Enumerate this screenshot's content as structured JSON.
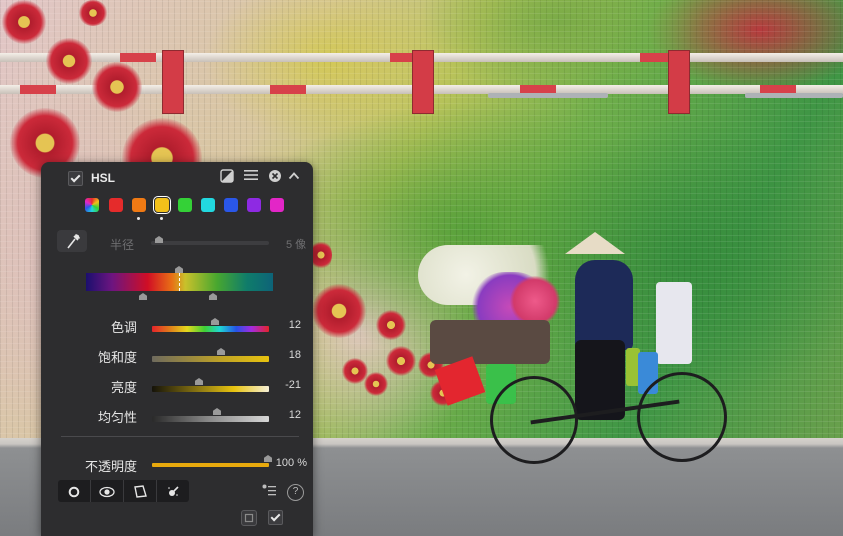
{
  "panel": {
    "title": "HSL",
    "colors": {
      "all": "multicolor",
      "red": "#e52b2b",
      "orange": "#f07a14",
      "yellow": "#f2c01a",
      "green": "#34d137",
      "aqua": "#22d8df",
      "blue": "#2a57e8",
      "purple": "#8e2ae3",
      "magenta": "#e326c7"
    },
    "selected_color": "yellow",
    "radius": {
      "label": "半径",
      "value": "5 像"
    },
    "sliders": [
      {
        "label": "色调",
        "value": "12"
      },
      {
        "label": "饱和度",
        "value": "18"
      },
      {
        "label": "亮度",
        "value": "-21"
      },
      {
        "label": "均匀性",
        "value": "12"
      }
    ],
    "opacity": {
      "label": "不透明度",
      "value": "100 %"
    },
    "header_icons": [
      "checkbox-icon",
      "mask-icon",
      "menu-icon",
      "close-icon",
      "collapse-icon"
    ],
    "footer_icons": [
      "circle-mask-icon",
      "eye-mask-icon",
      "polygon-mask-icon",
      "brush-mask-icon",
      "tone-list-icon",
      "help-icon",
      "reset-icon",
      "checkbox-icon"
    ]
  }
}
